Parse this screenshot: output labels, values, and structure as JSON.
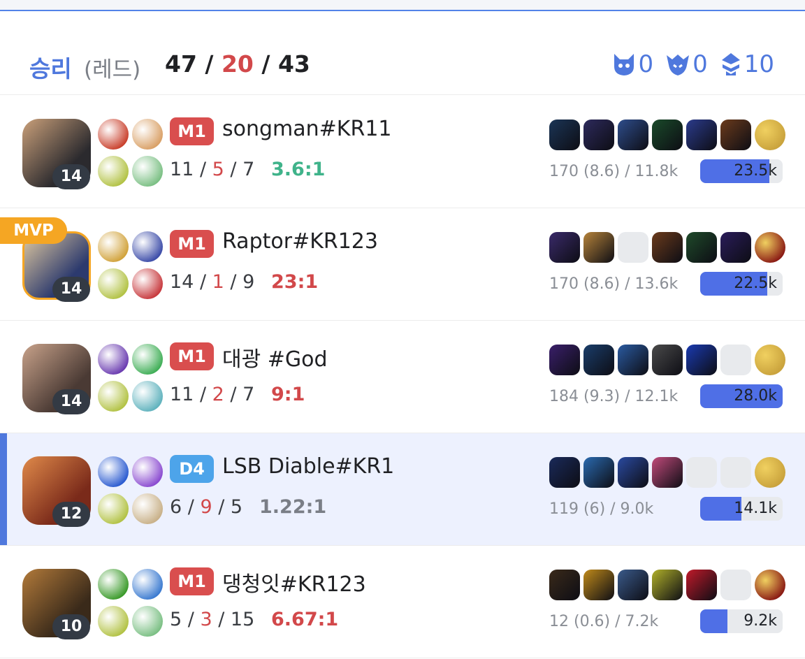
{
  "header": {
    "result": "승리",
    "team": "(레드)",
    "kills": "47",
    "deaths": "20",
    "assists": "43",
    "objectives": [
      {
        "icon": "baron-icon",
        "value": "0"
      },
      {
        "icon": "dragon-icon",
        "value": "0"
      },
      {
        "icon": "tower-icon",
        "value": "10"
      }
    ]
  },
  "colors": {
    "accent": "#4f78dd",
    "death": "#d2484a",
    "mvp": "#f5a623",
    "tier_master": "#d94e4e",
    "tier_diamond": "#4da4ea"
  },
  "players": [
    {
      "level": "14",
      "tier": "M1",
      "name": "songman#KR11",
      "k": "11",
      "d": "5",
      "a": "7",
      "ratio": "3.6:1",
      "ratio_color": "#3fb38a",
      "cs": "170 (8.6) / 11.8k",
      "damage": "23.5k",
      "damage_fraction": 0.84,
      "mvp": "",
      "champ_colors": [
        "#2b2a2e",
        "#caa07a"
      ],
      "spell_colors": [
        "#c9402c",
        "#d9a066"
      ],
      "rune_colors": [
        "#b2c244",
        "#7abf83"
      ],
      "item_colors": [
        "#1b3556",
        "#2d2a5c",
        "#2e4d8c",
        "#1a4a2a",
        "#2b3b8c",
        "#6b3b1c",
        "#c9a23c"
      ]
    },
    {
      "level": "14",
      "tier": "M1",
      "name": "Raptor#KR123",
      "k": "14",
      "d": "1",
      "a": "9",
      "ratio": "23:1",
      "ratio_color": "#d2484a",
      "cs": "170 (8.6) / 13.6k",
      "damage": "22.5k",
      "damage_fraction": 0.81,
      "mvp": "MVP",
      "champ_colors": [
        "#2c3a6e",
        "#e0c9a0"
      ],
      "spell_colors": [
        "#d1a23a",
        "#3b4ba8"
      ],
      "rune_colors": [
        "#b2c244",
        "#c7383c"
      ],
      "item_colors": [
        "#3a2a6a",
        "#b6833a",
        "",
        "#6b3b1c",
        "#1f4a2a",
        "#2a1c5a",
        "#8a1a14"
      ]
    },
    {
      "level": "14",
      "tier": "M1",
      "name": "대광 #God",
      "k": "11",
      "d": "2",
      "a": "7",
      "ratio": "9:1",
      "ratio_color": "#d2484a",
      "cs": "184 (9.3) / 12.1k",
      "damage": "28.0k",
      "damage_fraction": 1.0,
      "mvp": "",
      "champ_colors": [
        "#4a3a34",
        "#c8a28a"
      ],
      "spell_colors": [
        "#6a3bb0",
        "#3fae56"
      ],
      "rune_colors": [
        "#b2c244",
        "#5fb2bd"
      ],
      "item_colors": [
        "#3a1f6a",
        "#1a3d6a",
        "#2a5aa0",
        "#4a4a4a",
        "#1a3ab0",
        "",
        "#c9a23c"
      ]
    },
    {
      "level": "12",
      "tier": "D4",
      "name": "LSB Diable#KR1",
      "k": "6",
      "d": "9",
      "a": "5",
      "ratio": "1.22:1",
      "ratio_color": "#7a7e86",
      "cs": "119 (6) / 9.0k",
      "damage": "14.1k",
      "damage_fraction": 0.5,
      "mvp": "",
      "champ_colors": [
        "#7a2a1a",
        "#e08a4a"
      ],
      "spell_colors": [
        "#2a5ad0",
        "#8a4ad0"
      ],
      "rune_colors": [
        "#b2c244",
        "#c8b088"
      ],
      "item_colors": [
        "#1a2a5a",
        "#2a6ab0",
        "#2a4aa0",
        "#c04a7a",
        "",
        "",
        "#c9a23c"
      ],
      "me": true
    },
    {
      "level": "10",
      "tier": "M1",
      "name": "댕청잇#KR123",
      "k": "5",
      "d": "3",
      "a": "15",
      "ratio": "6.67:1",
      "ratio_color": "#d2484a",
      "cs": "12 (0.6) / 7.2k",
      "damage": "9.2k",
      "damage_fraction": 0.33,
      "mvp": "",
      "champ_colors": [
        "#3a2a1a",
        "#b27a3a"
      ],
      "spell_colors": [
        "#3a9a2a",
        "#3a7ad0"
      ],
      "rune_colors": [
        "#b2c244",
        "#7abf83"
      ],
      "item_colors": [
        "#3a2a1a",
        "#c08a1a",
        "#3a5a8a",
        "#b0b02a",
        "#c01a2a",
        "",
        "#8a1a14"
      ]
    }
  ]
}
